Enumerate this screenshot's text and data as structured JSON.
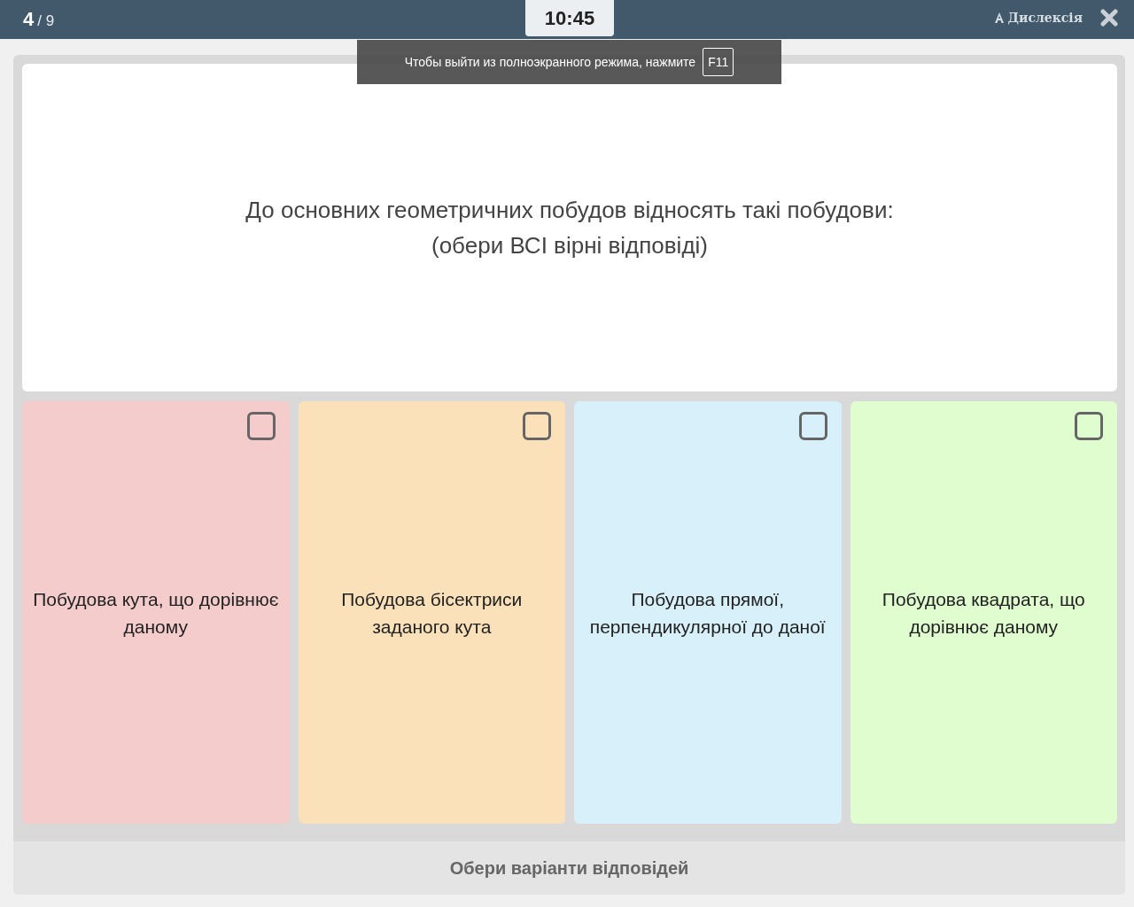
{
  "header": {
    "current": "4",
    "total": "/ 9",
    "timer": "10:45",
    "dyslexia_label": "Дислексія"
  },
  "toast": {
    "message": "Чтобы выйти из полноэкранного режима, нажмите",
    "key": "F11"
  },
  "question": {
    "lines": [
      "До основних геометричних побудов відносять такі побудови:",
      "(обери ВСІ вірні відповіді)"
    ]
  },
  "options": [
    {
      "text": "Побудова кута, що дорівнює даному",
      "color": "#f5cccc",
      "checked": false
    },
    {
      "text": "Побудова бісектриси заданого кута",
      "color": "#fbe1b9",
      "checked": false
    },
    {
      "text": "Побудова прямої, перпендикулярної до даної",
      "color": "#d7f0fa",
      "checked": false
    },
    {
      "text": "Побудова квадрата, що дорівнює даному",
      "color": "#dffdcf",
      "checked": false
    }
  ],
  "submit": {
    "label": "Обери варіанти відповідей"
  }
}
